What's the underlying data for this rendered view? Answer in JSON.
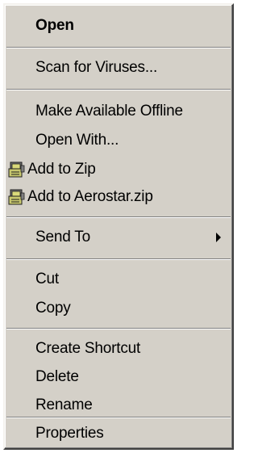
{
  "menu": {
    "open": "Open",
    "scan": "Scan for Viruses...",
    "offline": "Make Available Offline",
    "open_with": "Open With...",
    "add_zip": "Add to Zip",
    "add_named_zip": "Add to Aerostar.zip",
    "send_to": "Send To",
    "cut": "Cut",
    "copy": "Copy",
    "create_shortcut": "Create Shortcut",
    "delete": "Delete",
    "rename": "Rename",
    "properties": "Properties"
  },
  "icons": {
    "add_zip": "zip-archive-icon",
    "add_named_zip": "zip-archive-icon",
    "send_to_arrow": "chevron-right-icon"
  },
  "colors": {
    "menu_face": "#d4d0c8",
    "separator_dark": "#808080",
    "separator_light": "#ffffff",
    "text": "#000000"
  }
}
